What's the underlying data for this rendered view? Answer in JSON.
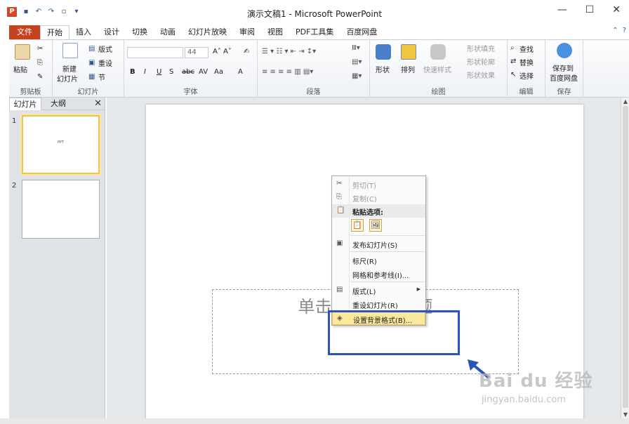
{
  "window": {
    "title": "演示文稿1 - Microsoft PowerPoint",
    "app_icon": "P",
    "quick_access": [
      "save-icon",
      "undo-icon",
      "redo-icon",
      "new-icon",
      "customize-icon"
    ],
    "controls": [
      "—",
      "☐",
      "✕"
    ]
  },
  "tabs": {
    "file": "文件",
    "items": [
      "开始",
      "插入",
      "设计",
      "切换",
      "动画",
      "幻灯片放映",
      "审阅",
      "视图",
      "PDF工具集",
      "百度网盘"
    ],
    "active": "开始",
    "right": [
      "⌃",
      "?"
    ]
  },
  "ribbon": {
    "clipboard": {
      "label": "剪贴板",
      "paste": "粘贴"
    },
    "slides": {
      "label": "幻灯片",
      "new_slide": "新建",
      "new_slide2": "幻灯片",
      "layout": "版式",
      "reset": "重设",
      "section": "节"
    },
    "font": {
      "label": "字体",
      "size": "44",
      "buttons": [
        "B",
        "I",
        "U",
        "S",
        "abc",
        "AV",
        "Aa",
        "A"
      ]
    },
    "paragraph": {
      "label": "段落"
    },
    "drawing": {
      "label": "绘图",
      "shapes": "形状",
      "arrange": "排列",
      "quick_styles": "快速样式",
      "fill": "形状填充",
      "outline": "形状轮廓",
      "effects": "形状效果"
    },
    "editing": {
      "label": "编辑",
      "find": "查找",
      "replace": "替换",
      "select": "选择"
    },
    "save": {
      "label": "保存",
      "save_to": "保存到",
      "baidu": "百度网盘"
    }
  },
  "left_panel": {
    "tab_slides": "幻灯片",
    "tab_outline": "大纲",
    "close": "✕",
    "slides": [
      {
        "num": "1",
        "text": "PPT"
      },
      {
        "num": "2",
        "text": ""
      }
    ]
  },
  "slide": {
    "placeholder": "单击此处添加标题"
  },
  "context_menu": {
    "items": [
      {
        "label": "剪切(T)",
        "icon": "✂"
      },
      {
        "label": "复制(C)",
        "icon": "⎘"
      },
      {
        "label": "粘贴选项:",
        "icon": "📋"
      },
      {
        "label": "发布幻灯片(S)",
        "icon": "▣"
      },
      {
        "label": "标尺(R)"
      },
      {
        "label": "网格和参考线(I)..."
      },
      {
        "label": "版式(L)",
        "icon": "▤"
      },
      {
        "label": "重设幻灯片(R)"
      },
      {
        "label": "设置背景格式(B)...",
        "icon": "◈"
      }
    ],
    "paste_icons": [
      "📋",
      "🖼"
    ]
  },
  "watermark": {
    "brand": "Bai du 经验",
    "url": "jingyan.baidu.com"
  },
  "colors": {
    "file_tab": "#c4431f",
    "highlight": "#fce89b",
    "annotation": "#2a55b8"
  }
}
